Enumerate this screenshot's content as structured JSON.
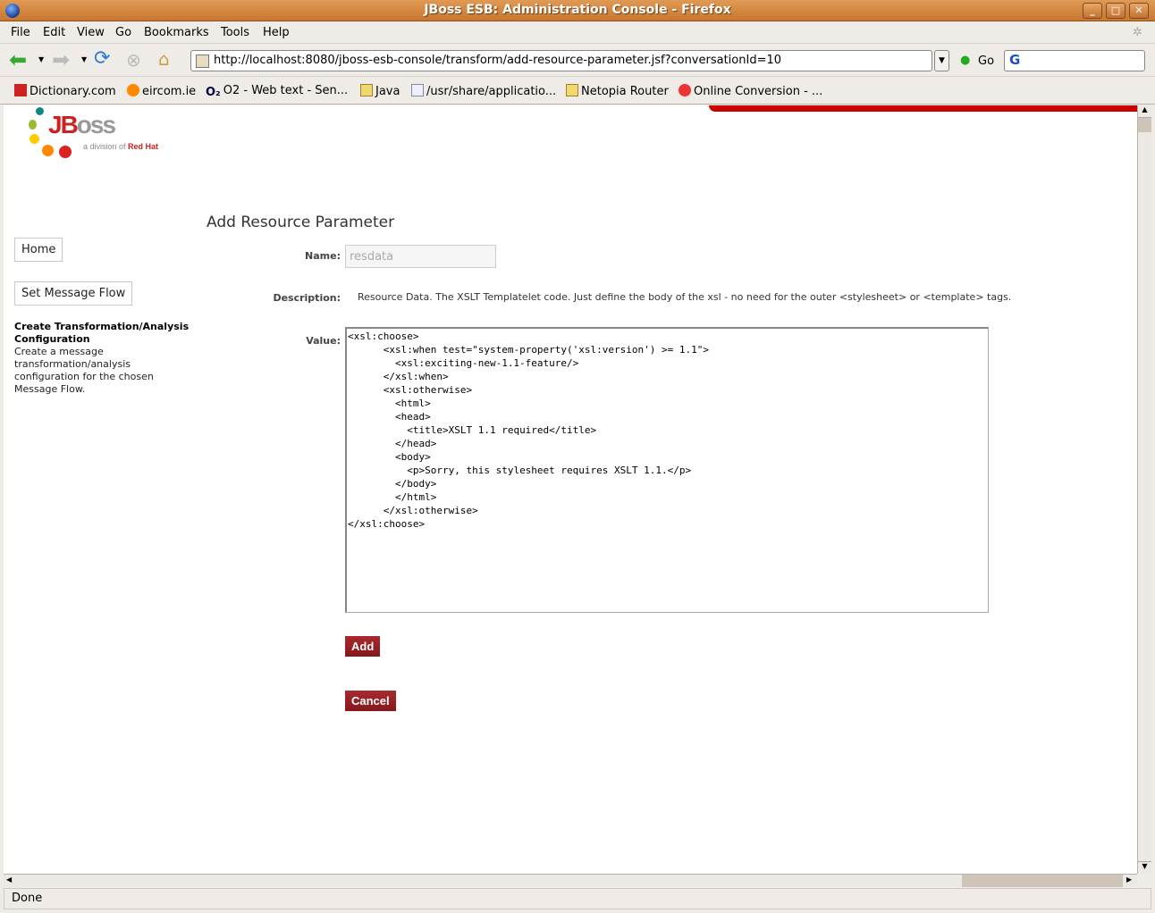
{
  "window": {
    "title": "JBoss ESB: Administration Console - Firefox"
  },
  "menu": [
    "File",
    "Edit",
    "View",
    "Go",
    "Bookmarks",
    "Tools",
    "Help"
  ],
  "nav": {
    "url": "http://localhost:8080/jboss-esb-console/transform/add-resource-parameter.jsf?conversationId=10",
    "go_label": "Go"
  },
  "bookmarks": [
    "Dictionary.com",
    "eircom.ie",
    "O2 - Web text - Sen...",
    "Java",
    "/usr/share/applicatio...",
    "Netopia Router",
    "Online Conversion - ..."
  ],
  "logo": {
    "brand": "JBoss",
    "tagline": "a division of Red Hat"
  },
  "sidebar": {
    "home": "Home",
    "set_flow": "Set Message Flow",
    "section_title": "Create Transformation/Analysis Configuration",
    "section_desc": "Create a message transformation/analysis configuration for the chosen Message Flow."
  },
  "form": {
    "title": "Add Resource Parameter",
    "name_label": "Name:",
    "name_value": "resdata",
    "desc_label": "Description:",
    "desc_text": "Resource Data. The XSLT Templatelet code. Just define the body of the xsl - no need for the outer <stylesheet> or <template> tags.",
    "value_label": "Value:",
    "value": "<xsl:choose>\n      <xsl:when test=\"system-property('xsl:version') >= 1.1\">\n        <xsl:exciting-new-1.1-feature/>\n      </xsl:when>\n      <xsl:otherwise>\n        <html>\n        <head>\n          <title>XSLT 1.1 required</title>\n        </head>\n        <body>\n          <p>Sorry, this stylesheet requires XSLT 1.1.</p>\n        </body>\n        </html>\n      </xsl:otherwise>\n</xsl:choose>",
    "add": "Add",
    "cancel": "Cancel"
  },
  "status": "Done",
  "colors": {
    "accent": "#8f1d22",
    "banner": "#cc0000"
  }
}
